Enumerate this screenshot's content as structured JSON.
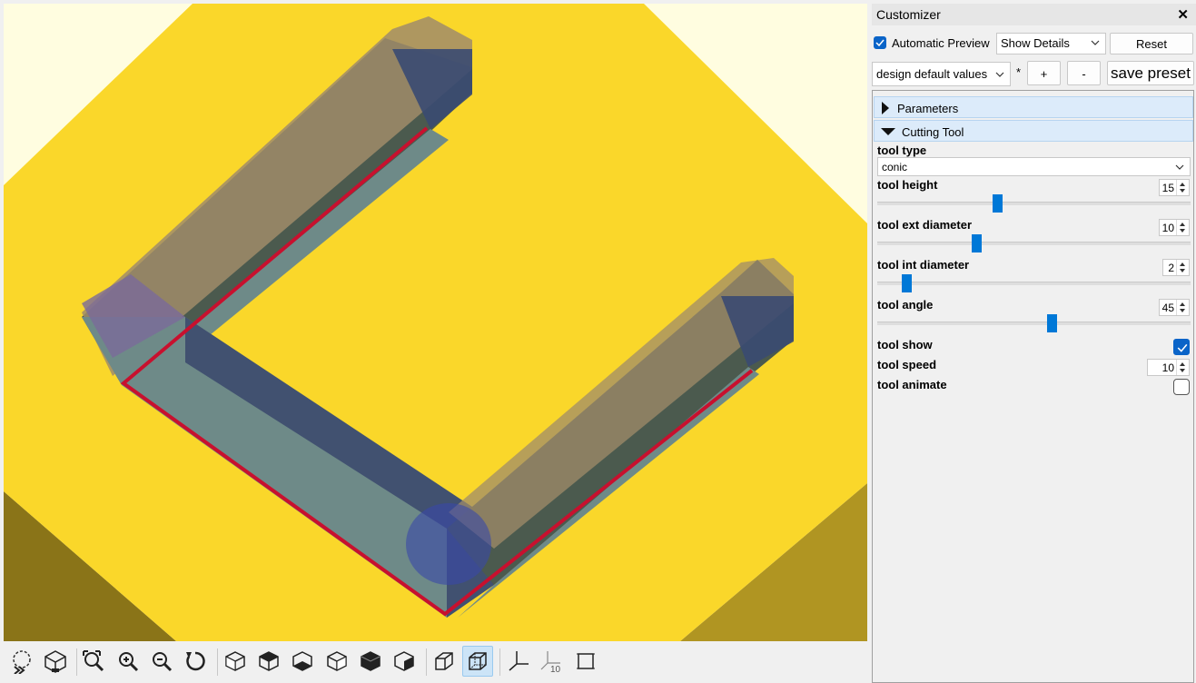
{
  "viewport": {
    "colors": {
      "background": "#fffde0",
      "plate": "#fad72a",
      "plate_shadow_left": "#8a7418",
      "plate_shadow_right": "#b09522",
      "groove_wall": "#4b5a4e",
      "groove_floor": "#6e8a88",
      "toolpath": "#c8102e",
      "tool_blue": "#3848a8"
    }
  },
  "toolbar": {
    "buttons": [
      {
        "name": "preview-button-icon",
        "active": false
      },
      {
        "name": "render-button-icon",
        "active": false
      },
      {
        "name": "view-all-icon",
        "active": false
      },
      {
        "name": "zoom-in-icon",
        "active": false
      },
      {
        "name": "zoom-out-icon",
        "active": false
      },
      {
        "name": "reset-view-icon",
        "active": false
      },
      {
        "name": "view-right-icon",
        "active": false
      },
      {
        "name": "view-top-icon",
        "active": false
      },
      {
        "name": "view-bottom-icon",
        "active": false
      },
      {
        "name": "view-left-icon",
        "active": false
      },
      {
        "name": "view-front-icon",
        "active": false
      },
      {
        "name": "view-back-icon",
        "active": false
      },
      {
        "name": "perspective-icon",
        "active": false
      },
      {
        "name": "orthogonal-icon",
        "active": true
      },
      {
        "name": "show-axes-icon",
        "active": false
      },
      {
        "name": "show-scale-markers-icon",
        "active": false
      },
      {
        "name": "show-edges-icon",
        "active": false
      }
    ],
    "scale_marker_label": "10"
  },
  "customizer": {
    "title": "Customizer",
    "close_glyph": "✕",
    "automatic_preview_label": "Automatic Preview",
    "automatic_preview_checked": true,
    "show_details": "Show Details",
    "reset_label": "Reset",
    "preset_value": "design default values",
    "preset_modified_marker": "*",
    "add_preset_label": "+",
    "remove_preset_label": "-",
    "save_preset_label": "save preset",
    "groups": [
      {
        "label": "Parameters",
        "expanded": false
      },
      {
        "label": "Cutting Tool",
        "expanded": true
      }
    ],
    "params": {
      "tool_type": {
        "label": "tool type",
        "value": "conic"
      },
      "tool_height": {
        "label": "tool height",
        "value": "15",
        "slider_fraction": 0.38
      },
      "tool_ext_diameter": {
        "label": "tool ext diameter",
        "value": "10",
        "slider_fraction": 0.31
      },
      "tool_int_diameter": {
        "label": "tool int diameter",
        "value": "2",
        "slider_fraction": 0.08
      },
      "tool_angle": {
        "label": "tool angle",
        "value": "45",
        "slider_fraction": 0.56
      },
      "tool_show": {
        "label": "tool show",
        "checked": true
      },
      "tool_speed": {
        "label": "tool speed",
        "value": "10"
      },
      "tool_animate": {
        "label": "tool animate",
        "checked": false
      }
    },
    "accent_color": "#0078d7"
  }
}
